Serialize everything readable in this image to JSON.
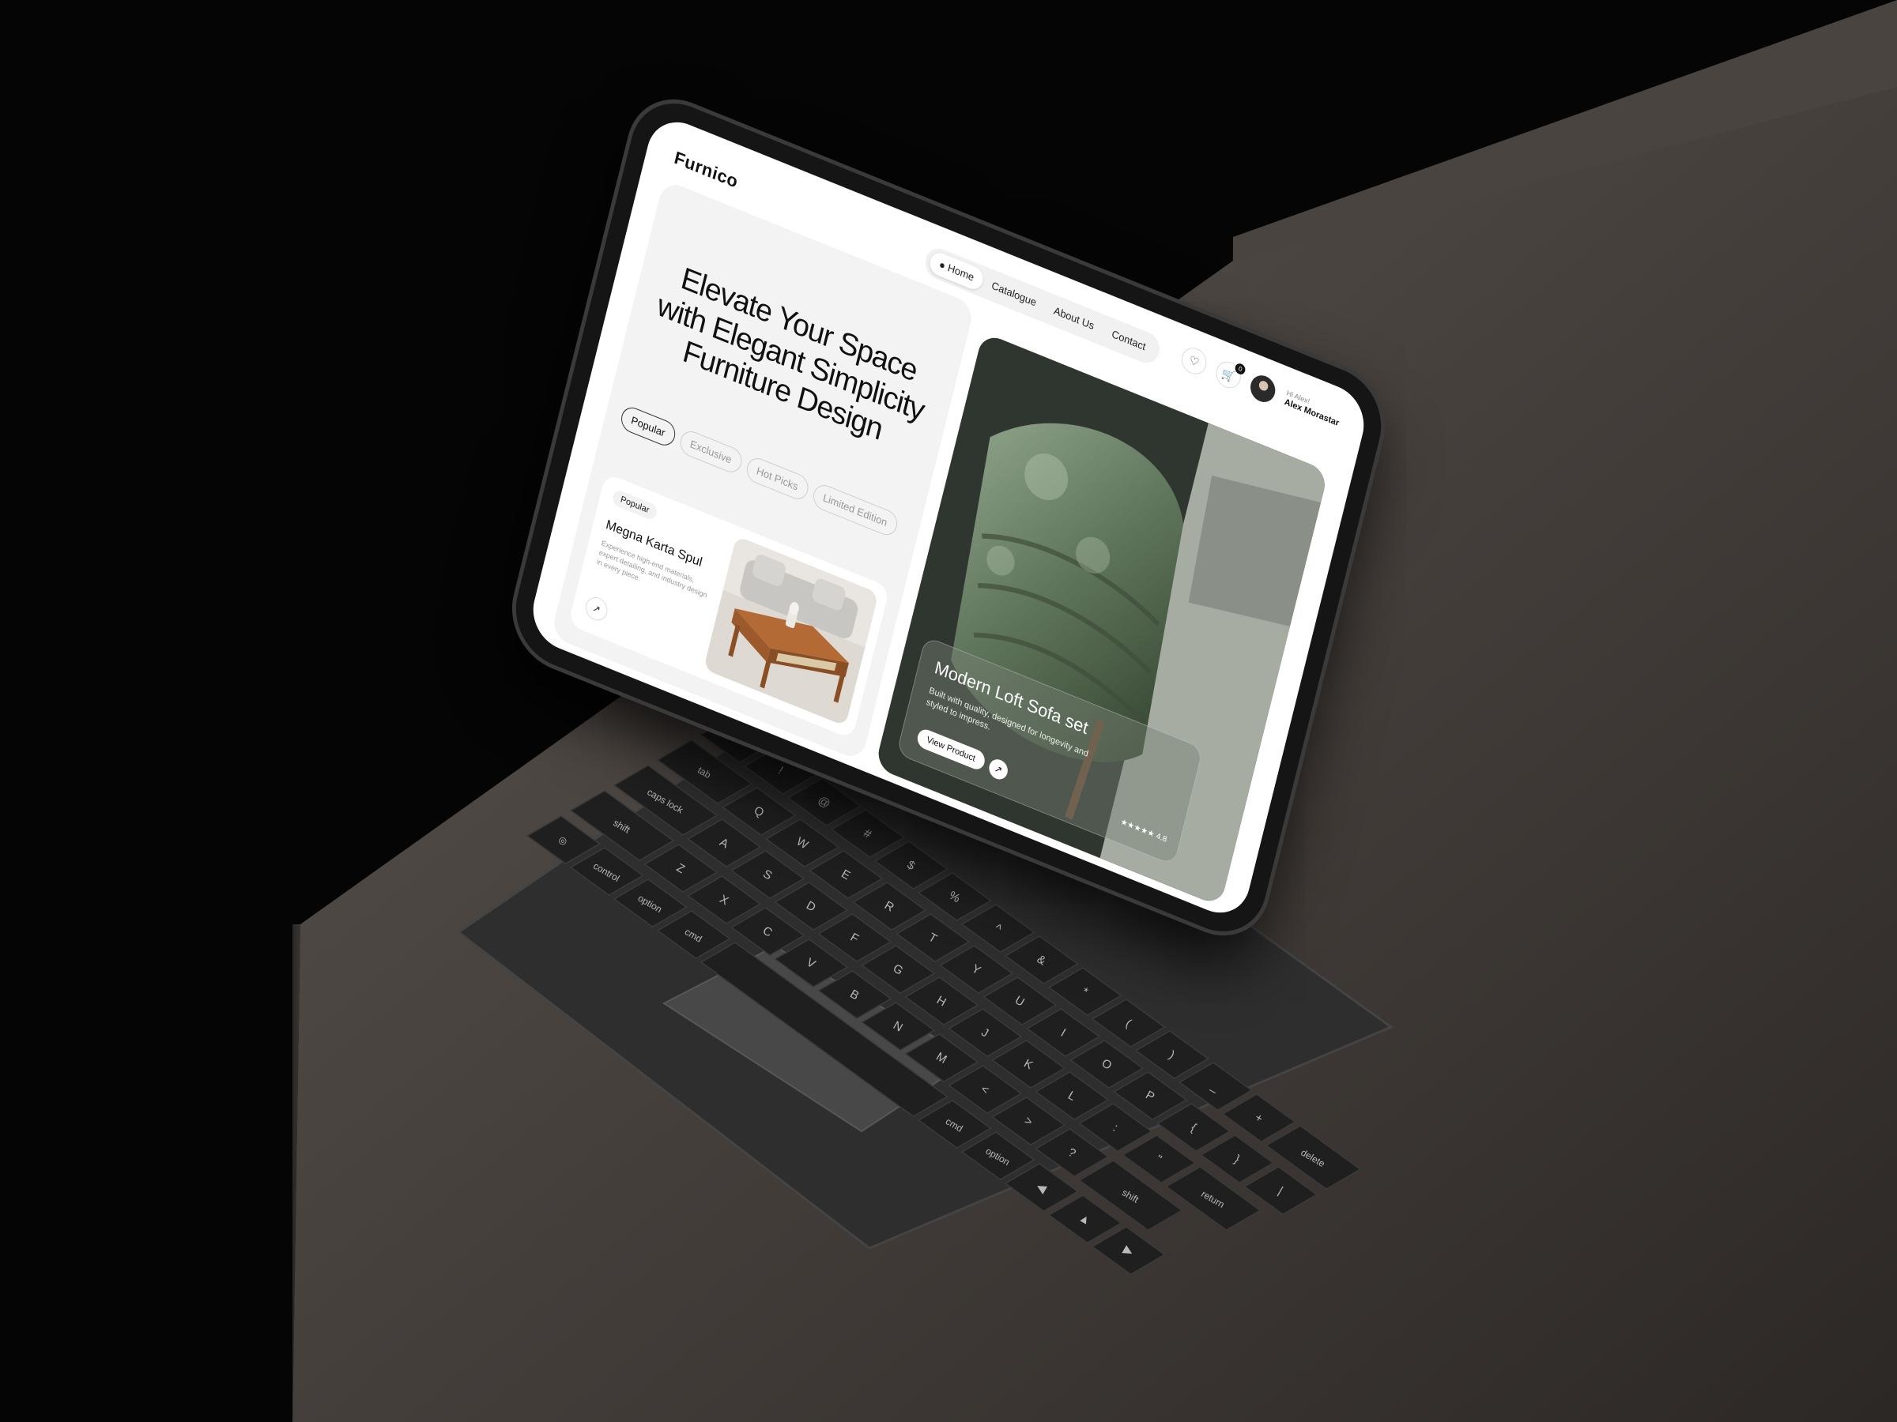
{
  "app": {
    "logo": "Furnico"
  },
  "nav": {
    "items": [
      {
        "label": "Home"
      },
      {
        "label": "Catalogue"
      },
      {
        "label": "About Us"
      },
      {
        "label": "Contact"
      }
    ]
  },
  "header": {
    "wishlist_icon": "heart-icon",
    "cart_icon": "cart-icon",
    "cart_count": "0",
    "user": {
      "greeting": "Hi Alex!",
      "name": "Alex Morastar"
    }
  },
  "hero": {
    "title_lines": [
      "Elevate Your Space",
      "with Elegant Simplicity",
      "Furniture Design"
    ],
    "chips": [
      {
        "label": "Popular"
      },
      {
        "label": "Exclusive"
      },
      {
        "label": "Hot Picks"
      },
      {
        "label": "Limited Edition"
      }
    ]
  },
  "product_card": {
    "tag": "Popular",
    "title": "Megna Karta Spul",
    "description": "Experience high-end materials, expert detailing, and industry design in every piece.",
    "arrow_icon": "arrow-up-right-icon"
  },
  "featured": {
    "title": "Modern Loft Sofa set",
    "description": "Built with quality, designed for longevity and styled to impress.",
    "button_label": "View Product",
    "button_icon": "arrow-up-right-icon",
    "rating_stars": "★★★★★",
    "rating_value": "4.8"
  },
  "keyboard": {
    "rows": [
      [
        "~",
        "!",
        "@",
        "#",
        "$",
        "%",
        "^",
        "&",
        "*",
        "(",
        ")",
        "_",
        "+",
        "delete"
      ],
      [
        "tab",
        "Q",
        "W",
        "E",
        "R",
        "T",
        "Y",
        "U",
        "I",
        "O",
        "P",
        "{",
        "}",
        "|"
      ],
      [
        "caps lock",
        "A",
        "S",
        "D",
        "F",
        "G",
        "H",
        "J",
        "K",
        "L",
        ":",
        "\"",
        "return"
      ],
      [
        "shift",
        "Z",
        "X",
        "C",
        "V",
        "B",
        "N",
        "M",
        "<",
        ">",
        "?",
        "shift"
      ],
      [
        "globe",
        "control",
        "option",
        "cmd",
        "",
        "cmd",
        "option",
        "◀",
        "▲",
        "▶"
      ]
    ]
  }
}
